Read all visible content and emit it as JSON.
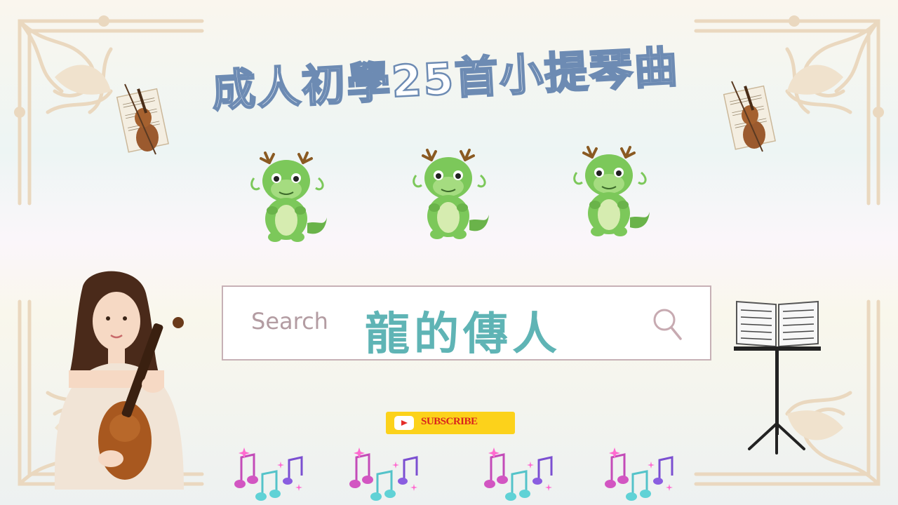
{
  "title": "成人初學25首小提琴曲",
  "search": {
    "placeholder": "Search",
    "query": "龍的傳人"
  },
  "subscribe": {
    "label": "SUBSCRIBE"
  },
  "icons": {
    "search": "search-icon",
    "play": "youtube-play-icon",
    "violin": "violin-icon",
    "dragon": "dragon-icon",
    "music_stand": "music-stand-icon",
    "music_notes": "music-notes-icon"
  },
  "colors": {
    "title_outline": "#6d8bb3",
    "query_text": "#5fb4b5",
    "subscribe_bg": "#fcd21b",
    "subscribe_text": "#d9251d",
    "frame": "#ead8bf"
  }
}
